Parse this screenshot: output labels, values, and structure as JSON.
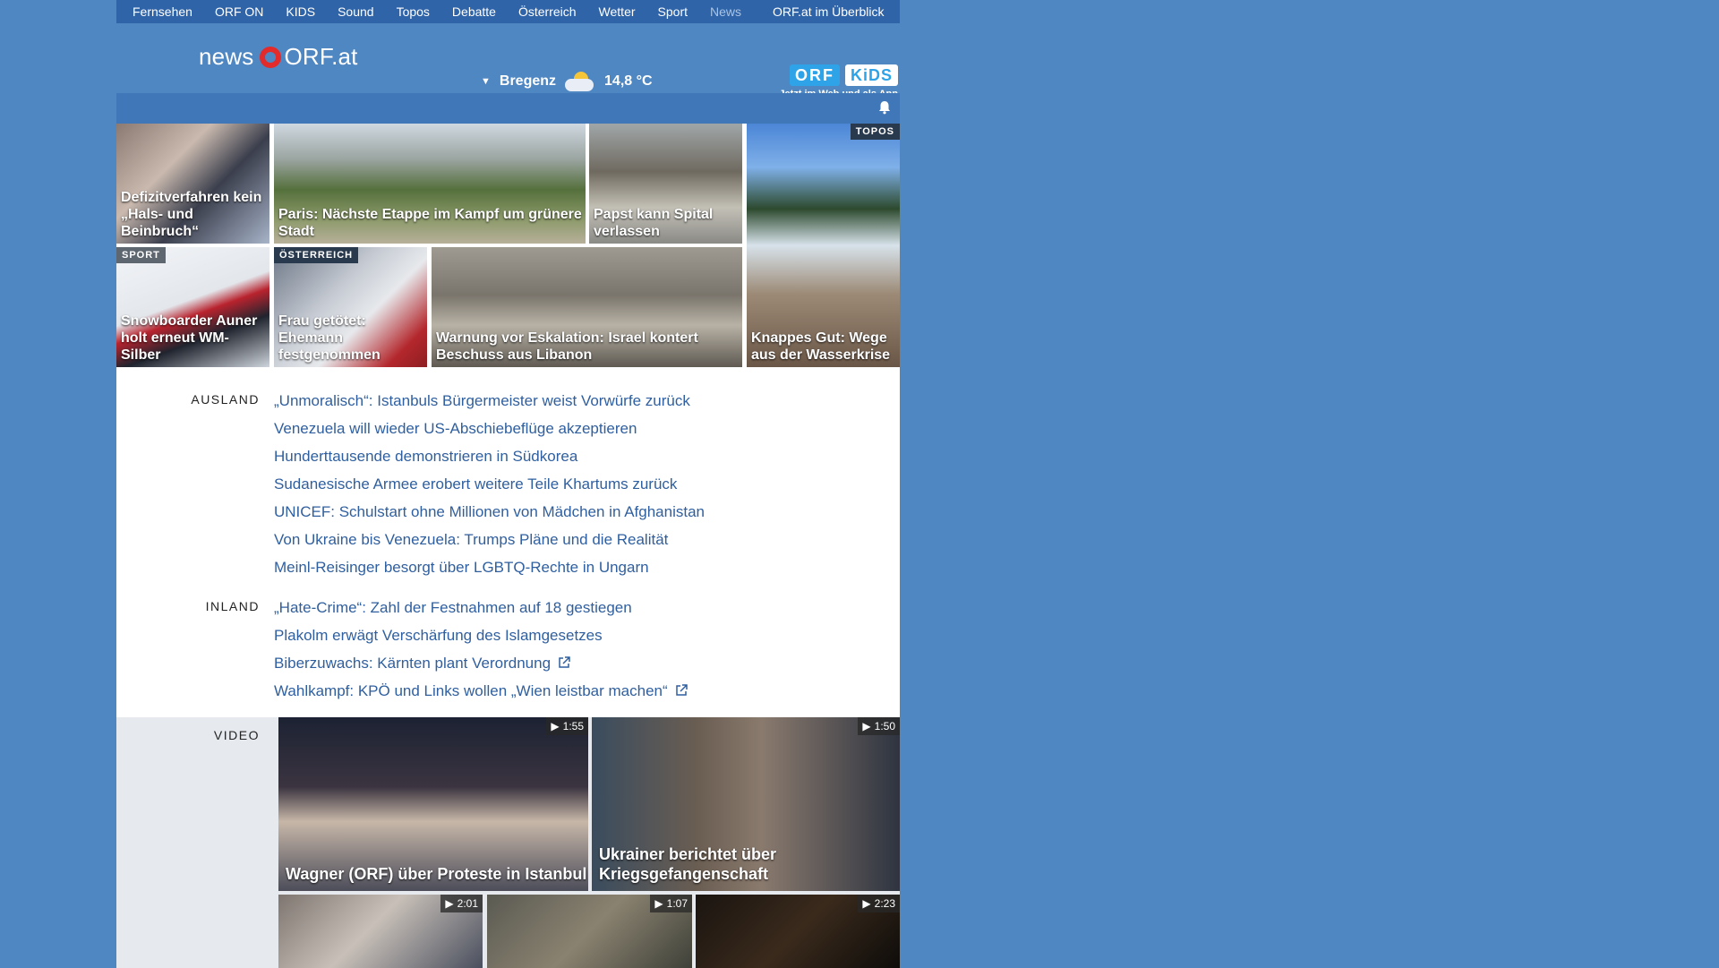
{
  "nav": {
    "items": [
      "Fernsehen",
      "ORF ON",
      "KIDS",
      "Sound",
      "Topos",
      "Debatte",
      "Österreich",
      "Wetter",
      "Sport",
      "News"
    ],
    "overview": "ORF.at im Überblick"
  },
  "header": {
    "logo_news": "news",
    "logo_site": "ORF.at",
    "weather_city": "Bregenz",
    "weather_temp": "14,8 °C",
    "kids_badge_left": "ORF",
    "kids_badge_right": "KiDS",
    "kids_sub": "Jetzt im Web und als App"
  },
  "teasers": [
    {
      "title": "Defizitverfahren kein „Hals- und Beinbruch“",
      "tag": ""
    },
    {
      "title": "Paris: Nächste Etappe im Kampf um grünere Stadt",
      "tag": ""
    },
    {
      "title": "Papst kann Spital verlassen",
      "tag": ""
    },
    {
      "title": "Knappes Gut: Wege aus der Wasserkrise",
      "tag": "TOPOS"
    },
    {
      "title": "Snowboarder Auner holt erneut WM-Silber",
      "tag": "SPORT"
    },
    {
      "title": "Frau getötet: Ehemann festgenommen",
      "tag": "ÖSTERREICH"
    },
    {
      "title": "Warnung vor Eskalation: Israel kontert Beschuss aus Libanon",
      "tag": ""
    }
  ],
  "ausland": {
    "label": "AUSLAND",
    "items": [
      "„Unmoralisch“: Istanbuls Bürgermeister weist Vorwürfe zurück",
      "Venezuela will wieder US-Abschiebeflüge akzeptieren",
      "Hunderttausende demonstrieren in Südkorea",
      "Sudanesische Armee erobert weitere Teile Khartums zurück",
      "UNICEF: Schulstart ohne Millionen von Mädchen in Afghanistan",
      "Von Ukraine bis Venezuela: Trumps Pläne und die Realität",
      "Meinl-Reisinger besorgt über LGBTQ-Rechte in Ungarn"
    ]
  },
  "inland": {
    "label": "INLAND",
    "items": [
      "„Hate-Crime“: Zahl der Festnahmen auf 18 gestiegen",
      "Plakolm erwägt Verschärfung des Islamgesetzes",
      "Biberzuwachs: Kärnten plant Verordnung",
      "Wahlkampf: KPÖ und Links wollen „Wien leistbar machen“"
    ]
  },
  "video": {
    "label": "VIDEO",
    "items": [
      {
        "title": "Wagner (ORF) über Proteste in Istanbul",
        "duration": "1:55"
      },
      {
        "title": "Ukrainer berichtet über Kriegsgefangenschaft",
        "duration": "1:50"
      },
      {
        "title": "",
        "duration": "2:01"
      },
      {
        "title": "",
        "duration": "1:07"
      },
      {
        "title": "",
        "duration": "2:23"
      }
    ]
  },
  "colors": {
    "background": "#4f87c2",
    "nav": "#2f64a8",
    "link": "#2f5f9f",
    "logo_red": "#e32b2b"
  }
}
